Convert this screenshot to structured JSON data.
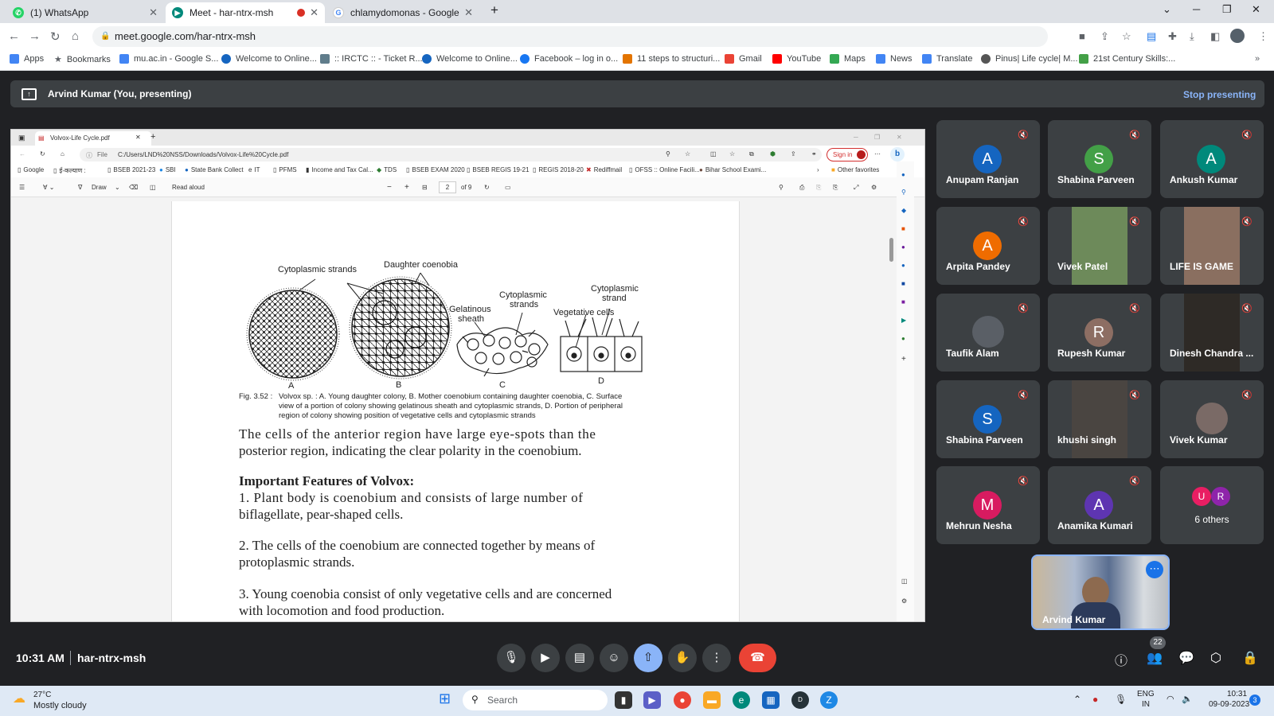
{
  "browser": {
    "tabs": [
      {
        "label": "(1) WhatsApp",
        "active": false
      },
      {
        "label": "Meet - har-ntrx-msh",
        "active": true
      },
      {
        "label": "chlamydomonas - Google Search",
        "active": false
      }
    ],
    "url": "meet.google.com/har-ntrx-msh",
    "bookmarks": [
      "Apps",
      "Bookmarks",
      "mu.ac.in - Google S...",
      "Welcome to Online...",
      ":: IRCTC :: - Ticket R...",
      "Welcome to Online...",
      "Facebook – log in o...",
      "11 steps to structuri...",
      "Gmail",
      "YouTube",
      "Maps",
      "News",
      "Translate",
      "Pinus| Life cycle| M...",
      "21st Century Skills:..."
    ]
  },
  "meet": {
    "presenting_label": "Arvind Kumar (You, presenting)",
    "stop_presenting": "Stop presenting",
    "time": "10:31 AM",
    "meeting_code": "har-ntrx-msh",
    "participant_count": "22"
  },
  "shared": {
    "tab_title": "Volvox-Life Cycle.pdf",
    "file_label": "File",
    "path": "C:/Users/LND%20NSS/Downloads/Volvox-Life%20Cycle.pdf",
    "sign_in": "Sign in",
    "favorites": [
      "Google",
      "ई-कल्याण :",
      "BSEB 2021-23",
      "SBI",
      "State Bank Collect",
      "IT",
      "PFMS",
      "Income and Tax Cal...",
      "TDS",
      "BSEB EXAM 2020",
      "BSEB REGIS 19-21",
      "REGIS 2018-20",
      "Rediffmail",
      "OFSS :: Online Facili...",
      "Bihar School Exami...",
      "Other favorites"
    ],
    "draw": "Draw",
    "read_aloud": "Read aloud",
    "page_num": "2",
    "page_of": "of 9",
    "fig_labels": {
      "cyto1": "Cytoplasmic strands",
      "daughter": "Daughter coenobia",
      "gel1": "Gelatinous",
      "gel2": "sheath",
      "cyto2a": "Cytoplasmic",
      "cyto2b": "strands",
      "cyto3a": "Cytoplasmic",
      "cyto3b": "strand",
      "veg": "Vegetative cells",
      "A": "A",
      "B": "B",
      "C": "C",
      "D": "D"
    },
    "caption_label": "Fig. 3.52 :",
    "caption_l1": "Volvox sp. : A. Young daughter colony, B. Mother coenobium containing daughter coenobia, C. Surface",
    "caption_l2": "view of a portion of colony showing gelatinous sheath and cytoplasmic strands, D. Portion of peripheral",
    "caption_l3": "region of colony showing position of vegetative cells and cytoplasmic strands",
    "p1_l1": "The cells of the anterior region have large eye-spots than the",
    "p1_l2": "posterior region, indicating the clear polarity in the coenobium.",
    "heading": "Important Features of Volvox:",
    "p2_l1": "1. Plant body is coenobium and consists of large number of",
    "p2_l2": "biflagellate, pear-shaped cells.",
    "p3_l1": "2. The cells of the coenobium are connected together by means of",
    "p3_l2": "protoplasmic strands.",
    "p4_l1": "3. Young coenobia consist of only vegetative cells and are concerned",
    "p4_l2": "with locomotion and food production."
  },
  "participants": [
    {
      "name": "Anupam Ranjan",
      "initial": "A",
      "color": "#1565c0"
    },
    {
      "name": "Shabina Parveen",
      "initial": "S",
      "color": "#43a047"
    },
    {
      "name": "Ankush Kumar",
      "initial": "A",
      "color": "#00897b"
    },
    {
      "name": "Arpita Pandey",
      "initial": "A",
      "color": "#ef6c00"
    },
    {
      "name": "Vivek Patel",
      "initial": "",
      "color": "#6d8a5a"
    },
    {
      "name": "LIFE IS GAME",
      "initial": "",
      "color": "#8a6f60"
    },
    {
      "name": "Taufik Alam",
      "initial": "",
      "color": "#5a5f66"
    },
    {
      "name": "Rupesh Kumar",
      "initial": "R",
      "color": "#8d6e63"
    },
    {
      "name": "Dinesh Chandra ...",
      "initial": "",
      "color": "#2e2a26"
    },
    {
      "name": "Shabina Parveen",
      "initial": "S",
      "color": "#1565c0"
    },
    {
      "name": "khushi singh",
      "initial": "",
      "color": "#4a4541"
    },
    {
      "name": "Vivek Kumar",
      "initial": "",
      "color": "#7a6a66"
    },
    {
      "name": "Mehrun Nesha",
      "initial": "M",
      "color": "#d81b60"
    },
    {
      "name": "Anamika Kumari",
      "initial": "A",
      "color": "#5e35b1"
    }
  ],
  "others": {
    "label": "6 others",
    "initials": [
      "U",
      "R"
    ]
  },
  "self_tile": {
    "name": "Arvind Kumar"
  },
  "taskbar": {
    "temp": "27°C",
    "weather": "Mostly cloudy",
    "search": "Search",
    "lang1": "ENG",
    "lang2": "IN",
    "clock_time": "10:31",
    "clock_date": "09-09-2023",
    "notif": "3"
  }
}
